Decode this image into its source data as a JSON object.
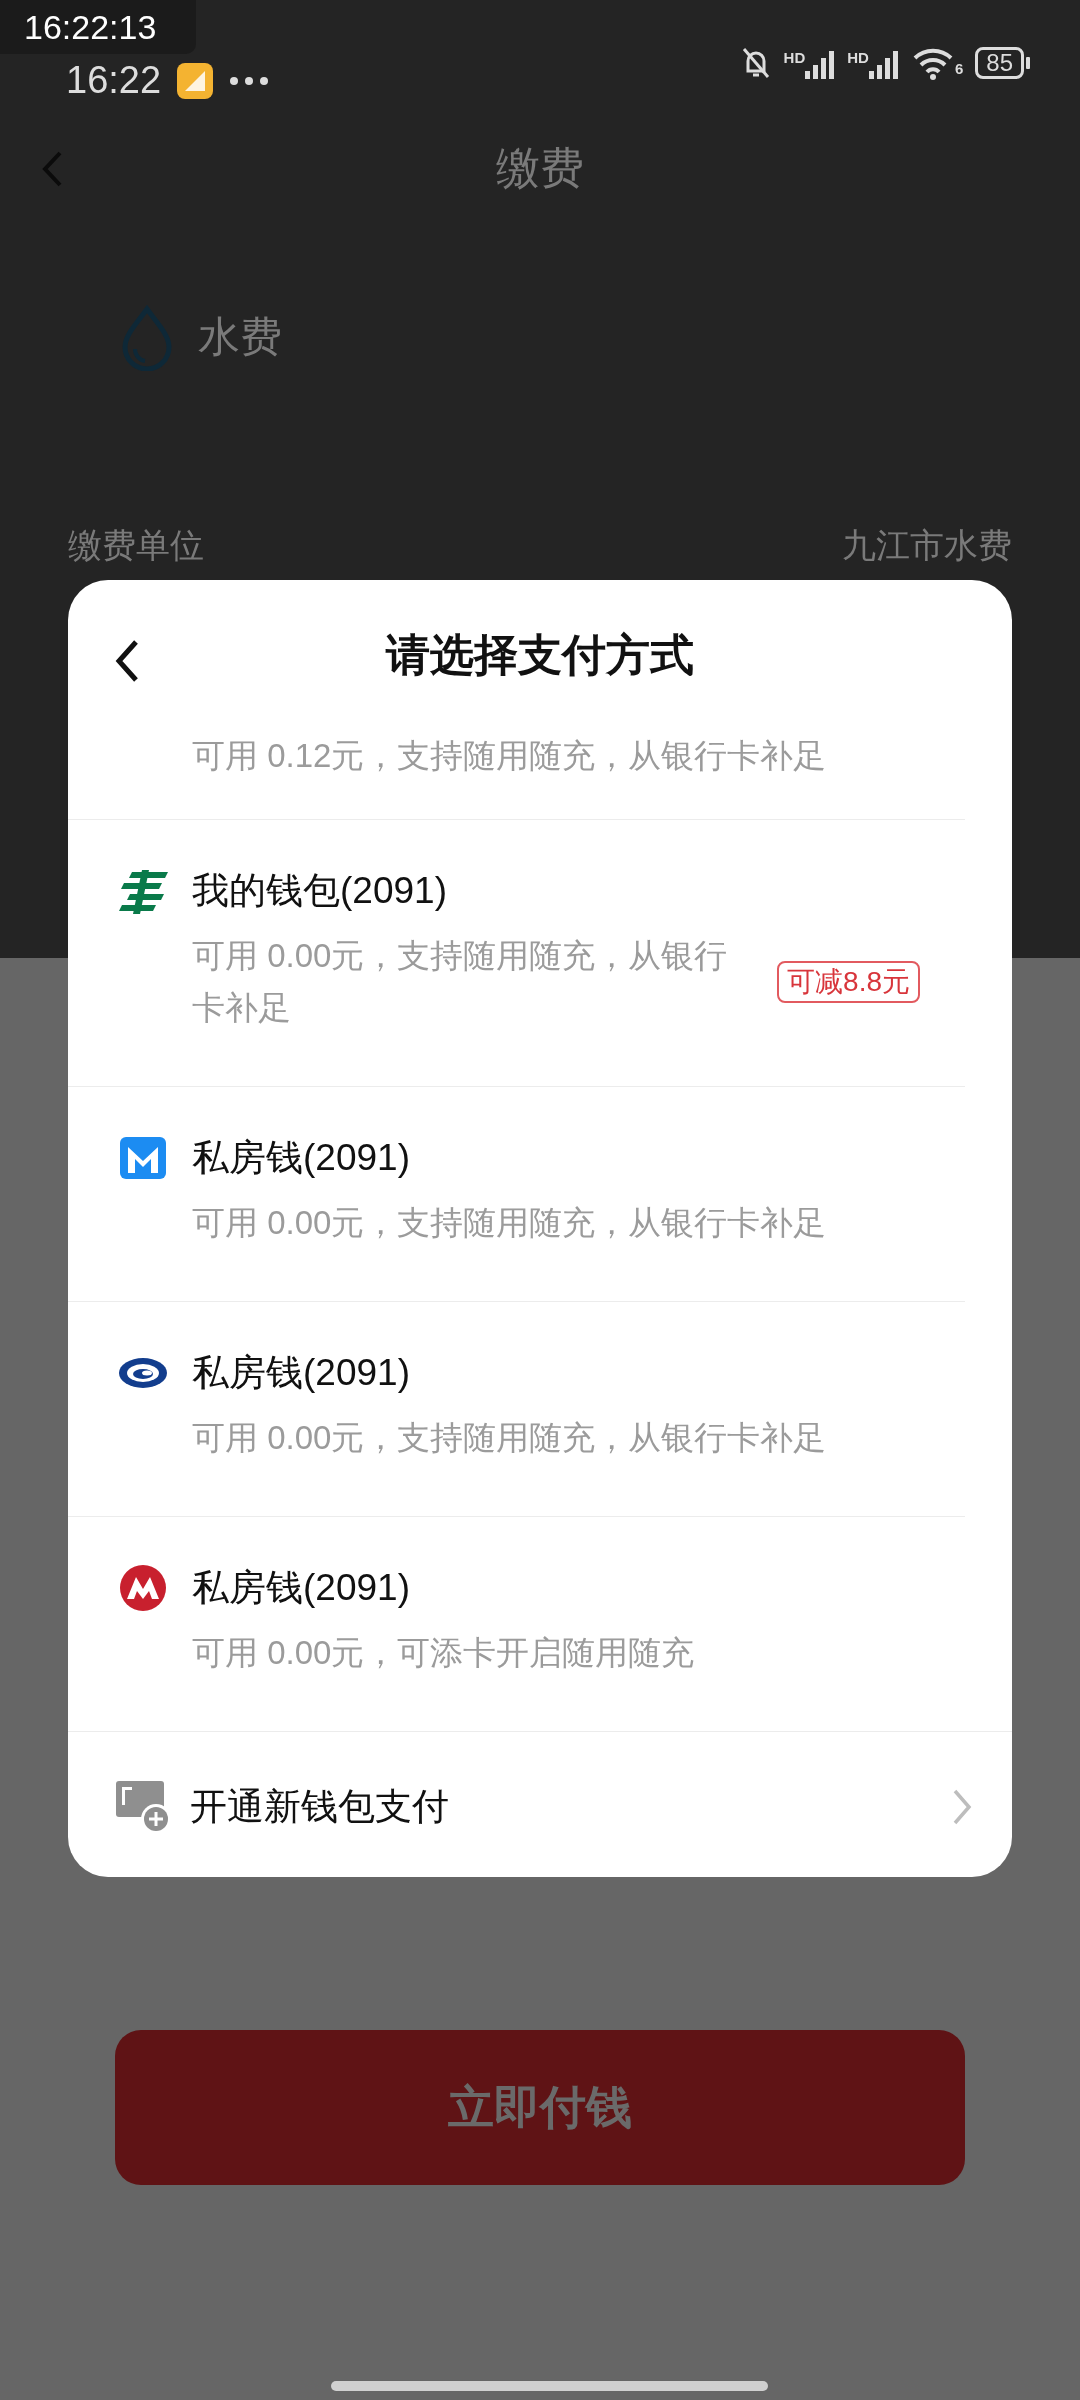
{
  "status_bar": {
    "overlay_time": "16:22:13",
    "time": "16:22",
    "network_labels": [
      "HD",
      "HD"
    ],
    "wifi_label": "6",
    "battery": "85"
  },
  "header": {
    "title": "缴费"
  },
  "bill": {
    "name": "水费",
    "fields": [
      {
        "label": "缴费单位",
        "value": "九江市水费"
      }
    ]
  },
  "payment_sheet": {
    "title": "请选择支付方式",
    "partial_item": {
      "subtitle": "可用 0.12元，支持随用随充，从银行卡补足"
    },
    "methods": [
      {
        "kind": "postal",
        "name": "我的钱包(2091)",
        "subtitle": "可用 0.00元，支持随用随充，从银行卡补足",
        "discount": "可减8.8元"
      },
      {
        "kind": "letter",
        "name": "私房钱(2091)",
        "subtitle": "可用 0.00元，支持随用随充，从银行卡补足"
      },
      {
        "kind": "swirl",
        "name": "私房钱(2091)",
        "subtitle": "可用 0.00元，支持随用随充，从银行卡补足"
      },
      {
        "kind": "circle",
        "name": "私房钱(2091)",
        "subtitle": "可用 0.00元，可添卡开启随用随充"
      }
    ],
    "add_option": {
      "label": "开通新钱包支付"
    }
  },
  "pay_button": {
    "label": "立即付钱"
  }
}
